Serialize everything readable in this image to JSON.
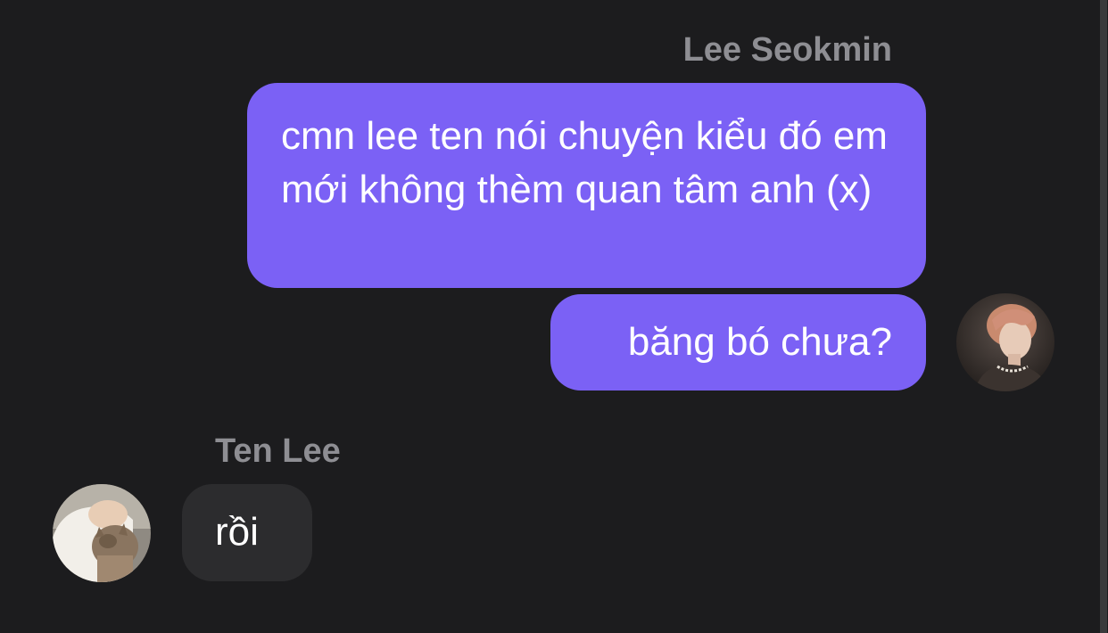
{
  "conversation": {
    "outgoing": {
      "sender_name": "Lee Seokmin",
      "messages": [
        {
          "text": "cmn lee ten nói chuyện kiểu đó em mới không thèm quan tâm anh (x)"
        },
        {
          "text": "băng bó chưa?"
        }
      ]
    },
    "incoming": {
      "sender_name": "Ten Lee",
      "messages": [
        {
          "text": "rồi"
        }
      ]
    }
  },
  "colors": {
    "background": "#1c1c1e",
    "outgoing_bubble": "#7b61f5",
    "incoming_bubble": "#2c2c2e",
    "sender_name": "#8e8e93"
  },
  "icons": {
    "outgoing_avatar": "user-photo-avatar",
    "incoming_avatar": "user-photo-avatar"
  }
}
